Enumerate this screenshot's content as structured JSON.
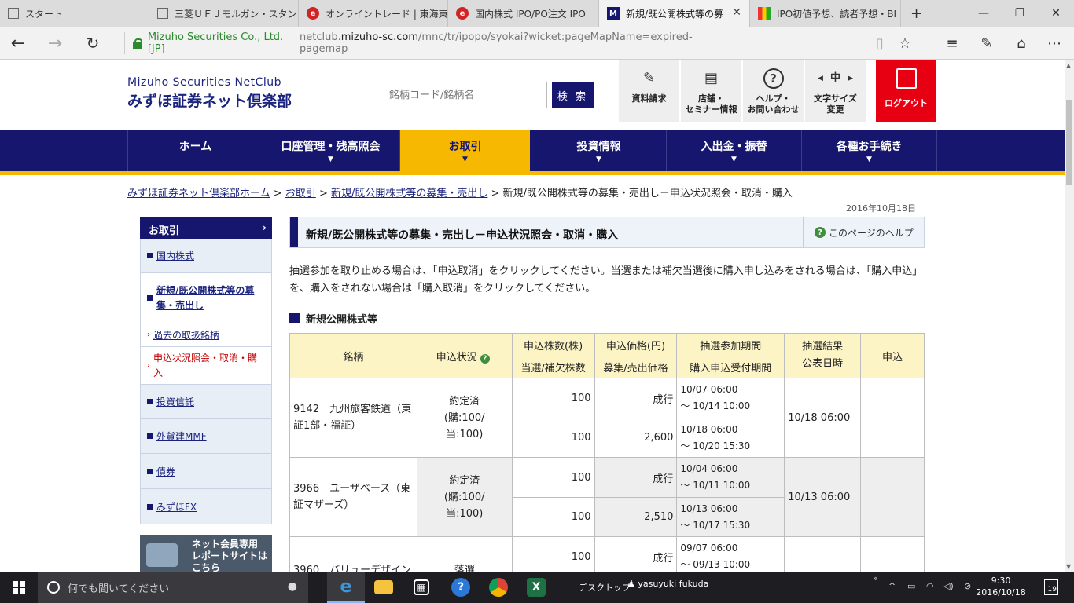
{
  "browser": {
    "tabs": [
      {
        "label": "スタート",
        "icon": "page-icon"
      },
      {
        "label": "三菱ＵＦＪモルガン・スタンレ",
        "icon": "page-icon"
      },
      {
        "label": "オンライントレード | 東海東京証",
        "icon": "red-circle-icon"
      },
      {
        "label": "国内株式 IPO/PO注文 IPO",
        "icon": "red-circle-icon"
      },
      {
        "label": "新規/既公開株式等の募",
        "icon": "mizuho-m-icon",
        "active": true
      },
      {
        "label": "IPO初値予想、読者予想・BI",
        "icon": "colorful-icon"
      }
    ],
    "new_tab": "+",
    "window_controls": {
      "minimize": "—",
      "restore": "❐",
      "close": "✕"
    },
    "address": {
      "corp": "Mizuho Securities Co., Ltd. [JP]",
      "url_prefix": "netclub.",
      "url_domain": "mizuho-sc.com",
      "url_path": "/mnc/tr/ipopo/syokai?wicket:pageMapName=expired-pagemap"
    }
  },
  "header": {
    "logo_en": "Mizuho Securities NetClub",
    "logo_jp": "みずほ証券ネット倶楽部",
    "search_placeholder": "銘柄コード/銘柄名",
    "search_button": "検 索",
    "utils": [
      {
        "line1": "資料請求",
        "line2": ""
      },
      {
        "line1": "店舗・",
        "line2": "セミナー情報"
      },
      {
        "line1": "ヘルプ・",
        "line2": "お問い合わせ"
      },
      {
        "line1": "文字サイズ",
        "line2": "変更"
      }
    ],
    "font_size_glyph": "中",
    "logout": "ログアウト"
  },
  "gnav": [
    {
      "label": "ホーム",
      "arrow": ""
    },
    {
      "label": "口座管理・残高照会",
      "arrow": "▼"
    },
    {
      "label": "お取引",
      "arrow": "▼",
      "active": true
    },
    {
      "label": "投資情報",
      "arrow": "▼"
    },
    {
      "label": "入出金・振替",
      "arrow": "▼"
    },
    {
      "label": "各種お手続き",
      "arrow": "▼"
    }
  ],
  "breadcrumb": {
    "links": [
      "みずほ証券ネット倶楽部ホーム",
      "お取引",
      "新規/既公開株式等の募集・売出し"
    ],
    "sep": " > ",
    "current": "新規/既公開株式等の募集・売出し－申込状況照会・取消・購入"
  },
  "date": "2016年10月18日",
  "sidebar": {
    "title": "お取引",
    "items": [
      {
        "label": "国内株式"
      },
      {
        "label": "新規/既公開株式等の募集・売出し"
      },
      {
        "label": "過去の取扱銘柄"
      },
      {
        "label": "申込状況照会・取消・購入"
      },
      {
        "label": "投資信託"
      },
      {
        "label": "外貨建MMF"
      },
      {
        "label": "債券"
      },
      {
        "label": "みずほFX"
      }
    ],
    "banner": "ネット会員専用\nレポートサイトは\nこちら"
  },
  "main": {
    "title": "新規/既公開株式等の募集・売出し－申込状況照会・取消・購入",
    "help": "このページのヘルプ",
    "intro": "抽選参加を取り止める場合は、「申込取消」をクリックしてください。当選または補欠当選後に購入申し込みをされる場合は、「購入申込」を、購入をされない場合は「購入取消」をクリックしてください。",
    "section": "新規公開株式等",
    "table": {
      "headers": {
        "meigara": "銘柄",
        "status": "申込状況",
        "shares_top": "申込株数(株)",
        "shares_bottom": "当選/補欠株数",
        "price_top": "申込価格(円)",
        "price_bottom": "募集/売出価格",
        "period_top": "抽選参加期間",
        "period_bottom": "購入申込受付期間",
        "result_line1": "抽選結果",
        "result_line2": "公表日時",
        "apply": "申込"
      },
      "rows": [
        {
          "name": "9142　九州旅客鉄道（東証1部・福証）",
          "status1": "約定済",
          "status2": "(購:100/",
          "status3": "当:100)",
          "shares1": "100",
          "price1": "成行",
          "period1a": "10/07 06:00",
          "period1b": "～ 10/14 10:00",
          "shares2": "100",
          "price2": "2,600",
          "period2a": "10/18 06:00",
          "period2b": "～ 10/20 15:30",
          "result": "10/18 06:00"
        },
        {
          "name": "3966　ユーザベース（東証マザーズ）",
          "status1": "約定済",
          "status2": "(購:100/",
          "status3": "当:100)",
          "shares1": "100",
          "price1": "成行",
          "period1a": "10/04 06:00",
          "period1b": "～ 10/11 10:00",
          "shares2": "100",
          "price2": "2,510",
          "period2a": "10/13 06:00",
          "period2b": "～ 10/17 15:30",
          "result": "10/13 06:00"
        },
        {
          "name": "3960　バリューデザイン",
          "status1": "落選",
          "shares1": "100",
          "price1": "成行",
          "period1a": "09/07 06:00",
          "period1b": "～ 09/13 10:00"
        }
      ]
    }
  },
  "taskbar": {
    "search_placeholder": "何でも聞いてください",
    "desktop": "デスクトップ",
    "user": "yasuyuki fukuda",
    "time": "9:30",
    "date": "2016/10/18",
    "notifications": "19",
    "tray_chevron": "»",
    "tray_up": "^"
  }
}
